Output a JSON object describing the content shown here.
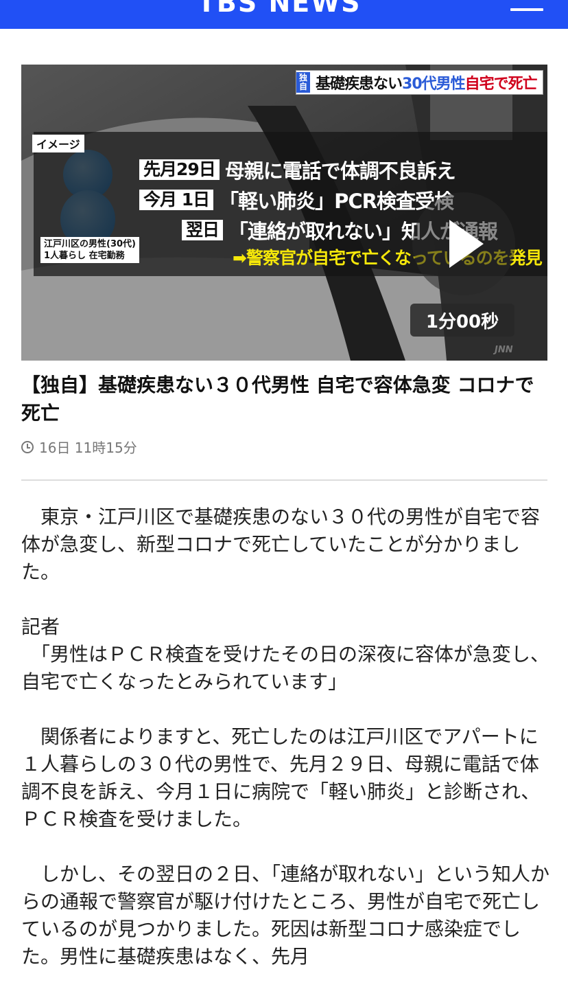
{
  "header": {
    "logo": "TBS NEWS",
    "menu_icon": "hamburger-menu-icon"
  },
  "video": {
    "banner_tag": "独自",
    "banner_parts": [
      "基礎疾患ない",
      "30代男性",
      "自宅で死亡"
    ],
    "image_label": "イメージ",
    "person_label_line1": "江戸川区の男性(30代)",
    "person_label_line2": "1人暮らし 在宅勤務",
    "rows": [
      {
        "date": "先月29日",
        "text": "母親に電話で体調不良訴え"
      },
      {
        "date": "今月 1日",
        "text": "「軽い肺炎」PCR検査受検"
      },
      {
        "date": "翌日",
        "text": "「連絡が取れない」知人が通報"
      }
    ],
    "result": "➡警察官が自宅で亡くなっているのを発見",
    "duration": "1分00秒",
    "watermark": "JNN",
    "play_icon": "play-icon"
  },
  "article": {
    "title": "【独自】基礎疾患ない３０代男性 自宅で容体急変 コロナで死亡",
    "timestamp": "16日 11時15分",
    "paragraphs": [
      "　東京・江戸川区で基礎疾患のない３０代の男性が自宅で容体が急変し、新型コロナで死亡していたことが分かりました。",
      "記者\n　「男性はＰＣＲ検査を受けたその日の深夜に容体が急変し、自宅で亡くなったとみられています」",
      "　関係者によりますと、死亡したのは江戸川区でアパートに１人暮らしの３０代の男性で、先月２９日、母親に電話で体調不良を訴え、今月１日に病院で「軽い肺炎」と診断され、ＰＣＲ検査を受けました。",
      "　しかし、その翌日の２日、「連絡が取れない」という知人からの通報で警察官が駆け付けたところ、男性が自宅で死亡しているのが見つかりました。死因は新型コロナ感染症でした。男性に基礎疾患はなく、先月"
    ]
  }
}
